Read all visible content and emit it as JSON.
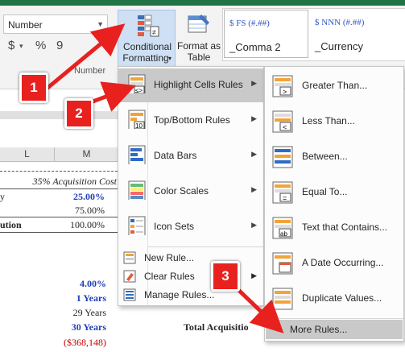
{
  "ribbon": {
    "number_format": "Number",
    "number_buttons": [
      "$",
      "%",
      "9"
    ],
    "group_label": "Number",
    "conditional_formatting": {
      "line1": "Conditional",
      "line2": "Formatting"
    },
    "format_as_table": {
      "line1": "Format as",
      "line2": "Table"
    },
    "styles": [
      {
        "top": "$ FS (#.##)",
        "bottom": "_Comma 2"
      },
      {
        "top": "$ NNN (#.##)",
        "bottom": "_Currency"
      }
    ]
  },
  "sheet": {
    "columns": [
      "L",
      "M"
    ],
    "header_note": "35% Acquisition Cost",
    "rows": [
      {
        "label": "y",
        "value": "25.00%"
      },
      {
        "label": "",
        "value": "75.00%"
      },
      {
        "label": "ution",
        "value": "100.00%"
      }
    ],
    "lower": [
      "4.00%",
      "1 Years",
      "29 Years",
      "30 Years",
      "($368,148)"
    ],
    "total_label": "Total Acquisitio"
  },
  "cf_menu": {
    "items": [
      {
        "label": "Highlight Cells Rules",
        "icon": "highlight-cells-icon"
      },
      {
        "label": "Top/Bottom Rules",
        "icon": "top-bottom-icon"
      },
      {
        "label": "Data Bars",
        "icon": "data-bars-icon"
      },
      {
        "label": "Color Scales",
        "icon": "color-scales-icon"
      },
      {
        "label": "Icon Sets",
        "icon": "icon-sets-icon"
      }
    ],
    "small_items": [
      {
        "label": "New Rule...",
        "icon": "new-rule-icon"
      },
      {
        "label": "Clear Rules",
        "icon": "clear-rules-icon"
      },
      {
        "label": "Manage Rules...",
        "icon": "manage-rules-icon"
      }
    ]
  },
  "submenu": {
    "items": [
      {
        "label": "Greater Than...",
        "icon": "greater-than-icon"
      },
      {
        "label": "Less Than...",
        "icon": "less-than-icon"
      },
      {
        "label": "Between...",
        "icon": "between-icon"
      },
      {
        "label": "Equal To...",
        "icon": "equal-to-icon"
      },
      {
        "label": "Text that Contains...",
        "icon": "text-contains-icon"
      },
      {
        "label": "A Date Occurring...",
        "icon": "date-occurring-icon"
      },
      {
        "label": "Duplicate Values...",
        "icon": "duplicate-values-icon"
      }
    ],
    "more_rules": "More Rules..."
  },
  "callouts": [
    "1",
    "2",
    "3"
  ],
  "colors": {
    "accent_red": "#e8211f",
    "excel_green": "#217346",
    "value_blue": "#1f3fb8",
    "value_red": "#c00000"
  }
}
